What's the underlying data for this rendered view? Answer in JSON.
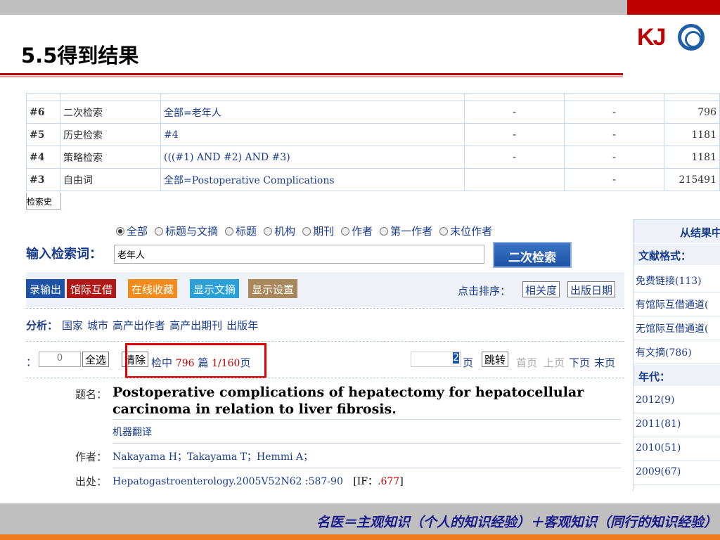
{
  "slide": {
    "title": "5.5得到结果",
    "logo": "KJ",
    "footer": "名医＝主观知识（个人的知识经验）＋客观知识（同行的知识经验）"
  },
  "history": {
    "rows": [
      {
        "num": "#6",
        "type": "二次检索",
        "expr": "全部=老年人",
        "a": "-",
        "b": "-",
        "count": "796"
      },
      {
        "num": "#5",
        "type": "历史检索",
        "expr": "#4",
        "a": "-",
        "b": "-",
        "count": "1181"
      },
      {
        "num": "#4",
        "type": "策略检索",
        "expr": "(((#1) AND #2) AND #3)",
        "a": "-",
        "b": "-",
        "count": "1181"
      },
      {
        "num": "#3",
        "type": "自由词",
        "expr": "全部=Postoperative Complications",
        "a": "",
        "b": "-",
        "count": "215491"
      }
    ],
    "tab_label": "检索史"
  },
  "search": {
    "fields": [
      "全部",
      "标题与文摘",
      "标题",
      "机构",
      "期刊",
      "作者",
      "第一作者",
      "末位作者"
    ],
    "label": "输入检索词：",
    "value": "老年人",
    "button": "二次检索"
  },
  "toolbar": {
    "export": "录输出",
    "interlibrary": "馆际互借",
    "collect": "在线收藏",
    "show_abstract": "显示文摘",
    "settings": "显示设置",
    "sort_label": "点击排序：",
    "sort_relevance": "相关度",
    "sort_date": "出版日期"
  },
  "analysis": {
    "label": "分析：",
    "items": [
      "国家",
      "城市",
      "高产出作者",
      "高产出期刊",
      "出版年"
    ]
  },
  "pager": {
    "prefix": "：",
    "page_input": "0",
    "select_all": "全选",
    "clear": "清除",
    "hits_prefix": "检中",
    "hits_count": "796",
    "hits_unit": "篇",
    "page_info": "1/160",
    "page_suffix": "页",
    "goto_value": "2",
    "goto_unit": "页",
    "goto_button": "跳转",
    "first": "首页",
    "prev": "上页",
    "next": "下页",
    "last": "末页"
  },
  "record": {
    "title_label": "题名：",
    "title": "Postoperative complications of hepatectomy for hepatocellular carcinoma in relation to liver fibrosis.",
    "machine_translate": "机器翻译",
    "author_label": "作者：",
    "authors": "Nakayama H；Takayama T；Hemmi A；",
    "source_label": "出处：",
    "source": "Hepatogastroenterology.2005V52N62 :587-90",
    "if_label": "[IF：",
    "if_value": ".677",
    "if_close": "]"
  },
  "right_panel": {
    "head": "从结果中",
    "format_head": "文献格式：",
    "formats": [
      "免费链接(113)",
      "有馆际互借通道(",
      "无馆际互借通道(",
      "有文摘(786)"
    ],
    "year_head": "年代：",
    "years": [
      "2012(9)",
      "2011(81)",
      "2010(51)",
      "2009(67)"
    ]
  },
  "colors": {
    "accent_red": "#c00000",
    "link_blue": "#1a3c8c",
    "footer_orange": "#f07c1e"
  }
}
